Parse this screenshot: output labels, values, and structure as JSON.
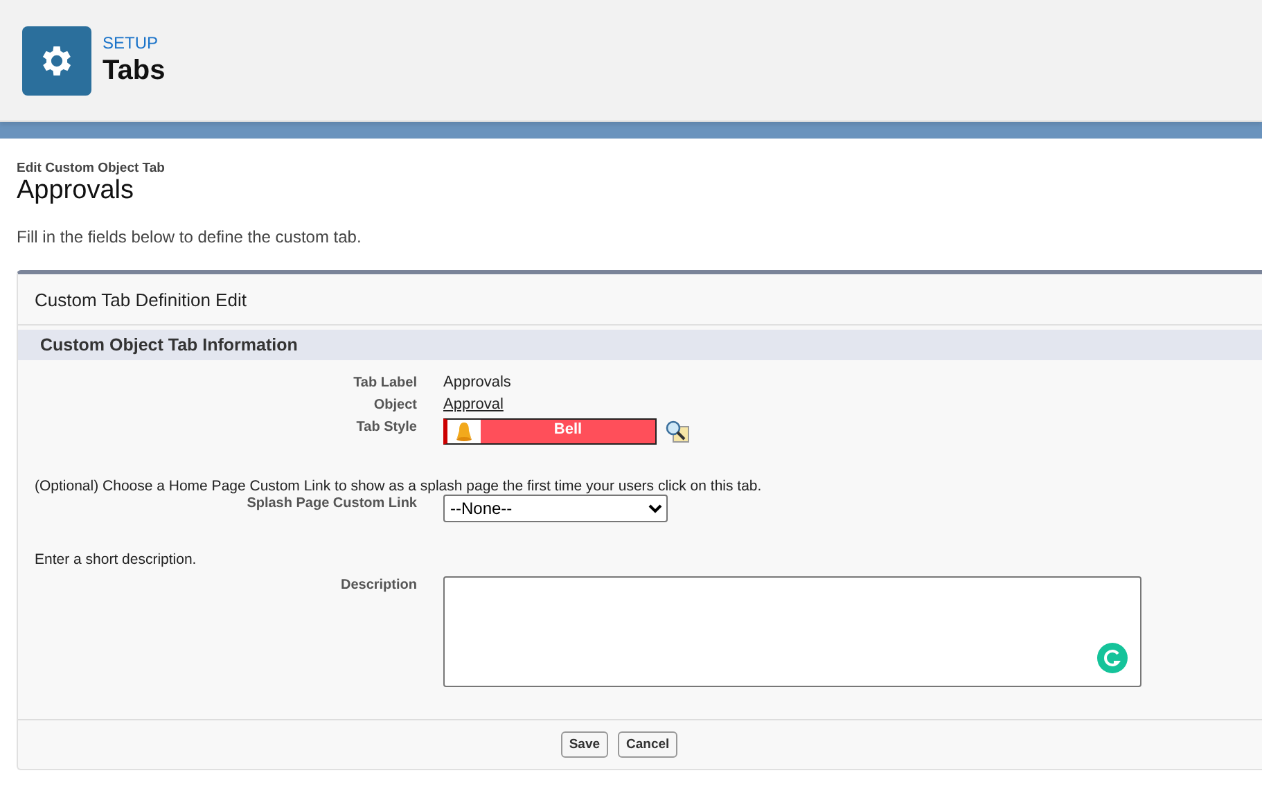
{
  "header": {
    "eyebrow": "SETUP",
    "title": "Tabs"
  },
  "page": {
    "subtitle": "Edit Custom Object Tab",
    "title": "Approvals",
    "intro": "Fill in the fields below to define the custom tab."
  },
  "panel": {
    "title": "Custom Tab Definition Edit",
    "section": "Custom Object Tab Information",
    "fields": [
      {
        "kind": "text",
        "label": "Tab Label",
        "value": "Approvals"
      },
      {
        "kind": "link",
        "label": "Object",
        "value": "Approval"
      },
      {
        "kind": "style",
        "label": "Tab Style",
        "value": "Bell",
        "color": "#ff4f5a"
      }
    ],
    "splash_note": "(Optional) Choose a Home Page Custom Link to show as a splash page the first time your users click on this tab.",
    "splash": {
      "label": "Splash Page Custom Link",
      "value": "--None--"
    },
    "description_note": "Enter a short description.",
    "description": {
      "label": "Description"
    },
    "buttons": [
      "Save",
      "Cancel"
    ]
  }
}
